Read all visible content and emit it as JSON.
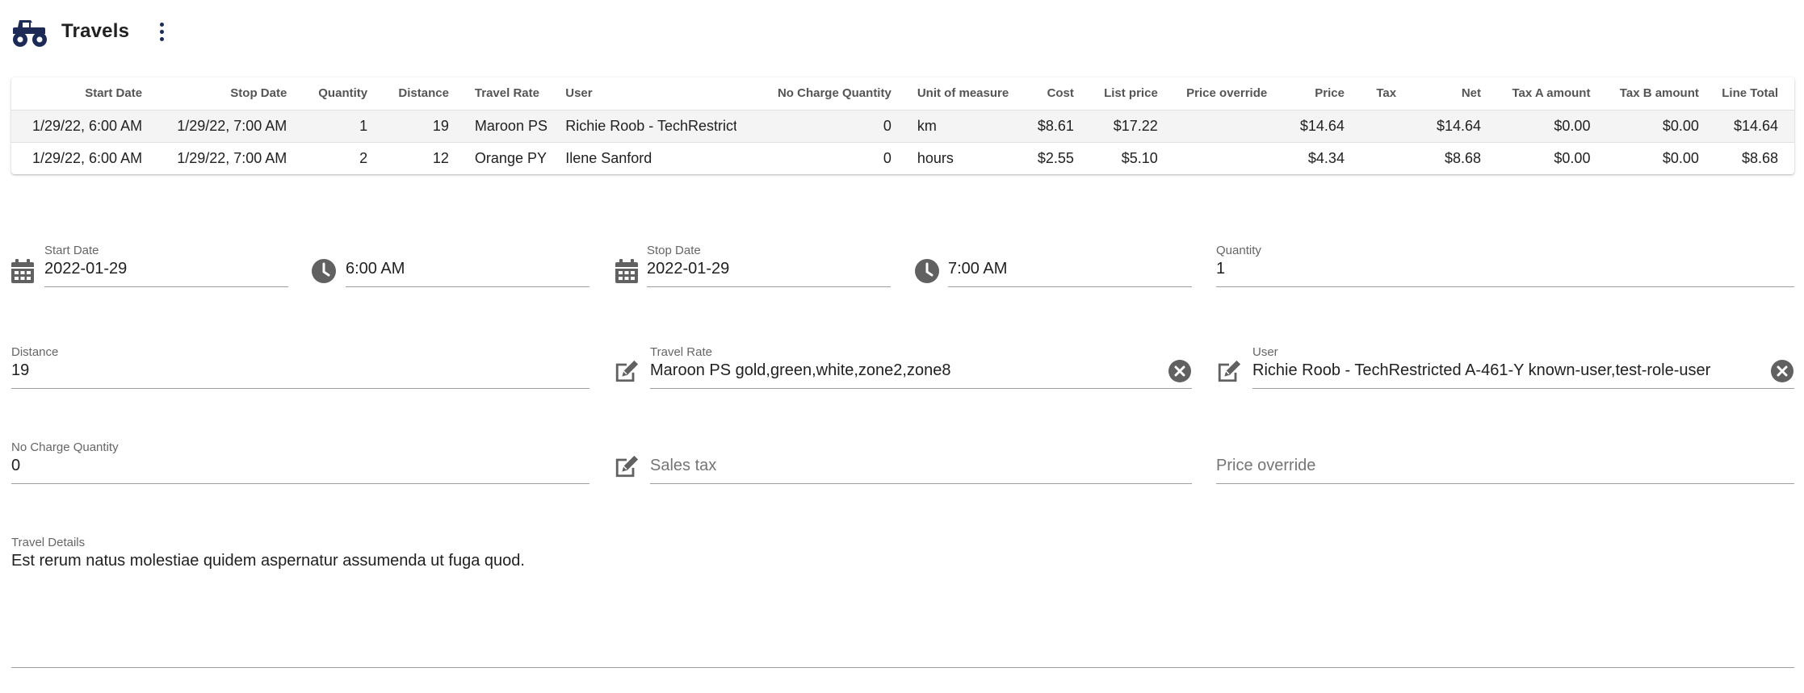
{
  "header": {
    "title": "Travels",
    "logo_icon": "monster-truck-icon",
    "menu_icon": "more-vertical-icon"
  },
  "colors": {
    "brand": "#1c2a55",
    "icon_gray": "#616161",
    "row_highlight": "#f4f4f4"
  },
  "table": {
    "columns": [
      "Start Date",
      "Stop Date",
      "Quantity",
      "Distance",
      "Travel Rate",
      "User",
      "No Charge Quantity",
      "Unit of measure",
      "Cost",
      "List price",
      "Price override",
      "Price",
      "Tax",
      "Net",
      "Tax A amount",
      "Tax B amount",
      "Line Total"
    ],
    "rows": [
      {
        "start_date": "1/29/22, 6:00 AM",
        "stop_date": "1/29/22, 7:00 AM",
        "quantity": "1",
        "distance": "19",
        "travel_rate": "Maroon PS",
        "user": "Richie Roob - TechRestricted",
        "no_charge_quantity": "0",
        "unit": "km",
        "cost": "$8.61",
        "list_price": "$17.22",
        "price_override": "",
        "price": "$14.64",
        "tax": "",
        "net": "$14.64",
        "tax_a": "$0.00",
        "tax_b": "$0.00",
        "line_total": "$14.64"
      },
      {
        "start_date": "1/29/22, 6:00 AM",
        "stop_date": "1/29/22, 7:00 AM",
        "quantity": "2",
        "distance": "12",
        "travel_rate": "Orange PY",
        "user": "Ilene Sanford",
        "no_charge_quantity": "0",
        "unit": "hours",
        "cost": "$2.55",
        "list_price": "$5.10",
        "price_override": "",
        "price": "$4.34",
        "tax": "",
        "net": "$8.68",
        "tax_a": "$0.00",
        "tax_b": "$0.00",
        "line_total": "$8.68"
      }
    ]
  },
  "form": {
    "start_date": {
      "label": "Start Date",
      "value": "2022-01-29",
      "icon": "calendar-icon"
    },
    "start_time": {
      "value": "6:00 AM",
      "icon": "clock-icon"
    },
    "stop_date": {
      "label": "Stop Date",
      "value": "2022-01-29",
      "icon": "calendar-icon"
    },
    "stop_time": {
      "value": "7:00 AM",
      "icon": "clock-icon"
    },
    "quantity": {
      "label": "Quantity",
      "value": "1"
    },
    "distance": {
      "label": "Distance",
      "value": "19"
    },
    "travel_rate": {
      "label": "Travel Rate",
      "value": "Maroon PS gold,green,white,zone2,zone8",
      "icon": "edit-icon",
      "clear_icon": "clear-icon"
    },
    "user": {
      "label": "User",
      "value": "Richie Roob - TechRestricted A-461-Y known-user,test-role-user",
      "icon": "edit-icon",
      "clear_icon": "clear-icon"
    },
    "no_charge_quantity": {
      "label": "No Charge Quantity",
      "value": "0"
    },
    "sales_tax": {
      "placeholder": "Sales tax",
      "icon": "edit-icon"
    },
    "price_override": {
      "placeholder": "Price override"
    },
    "travel_details": {
      "label": "Travel Details",
      "value": "Est rerum natus molestiae quidem aspernatur assumenda ut fuga quod."
    }
  }
}
